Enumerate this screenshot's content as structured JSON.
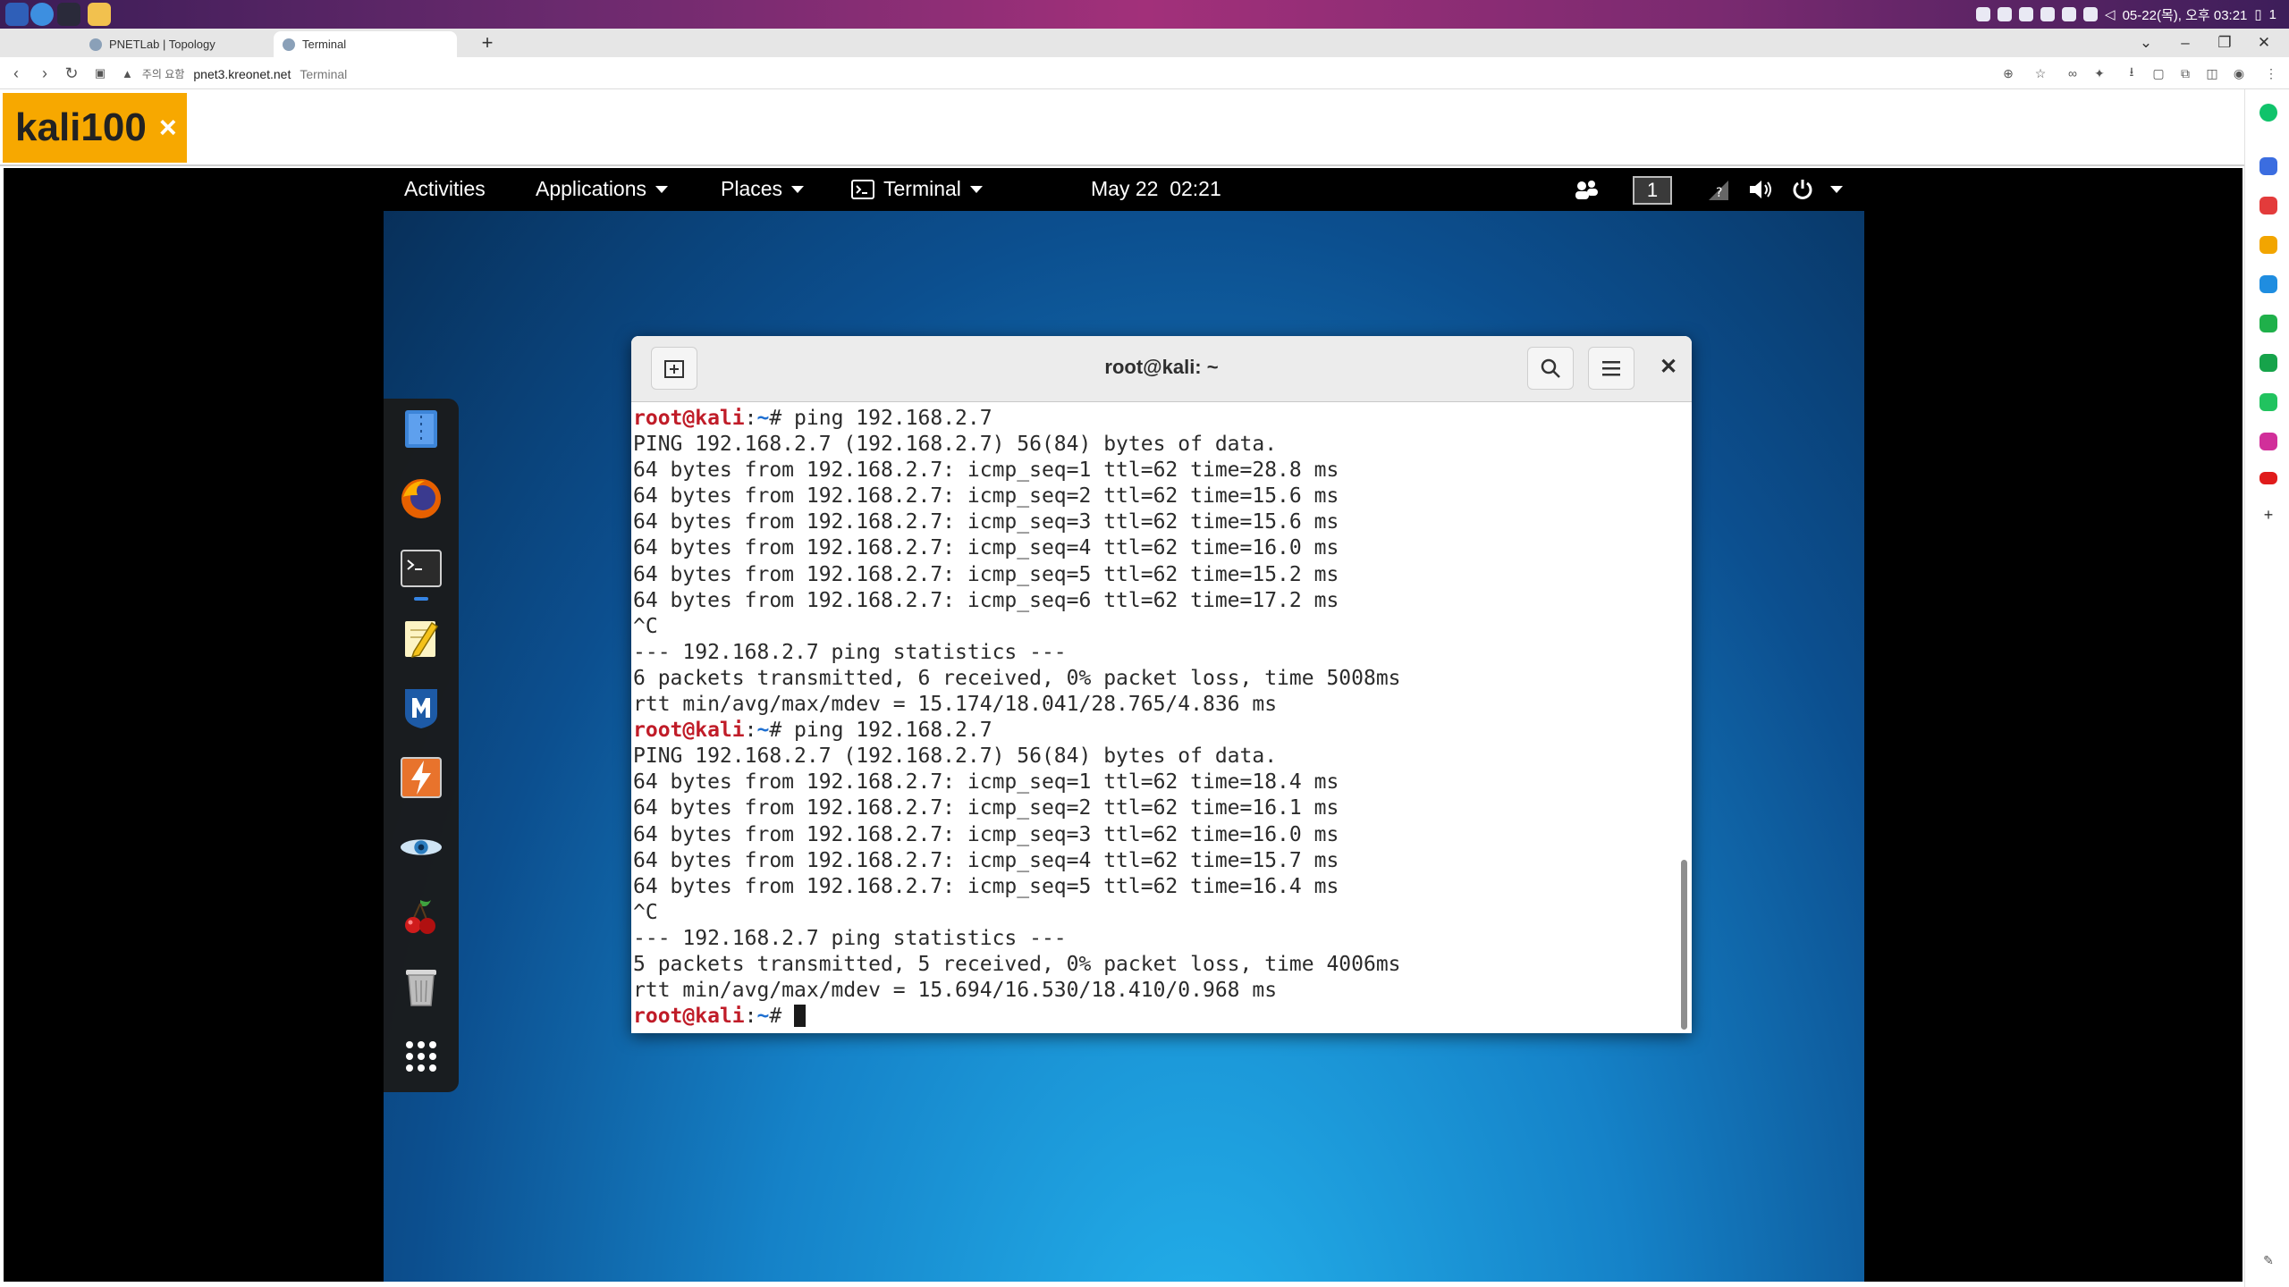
{
  "browser": {
    "tabs": [
      {
        "label": "PNETLab | Topology",
        "active": false
      },
      {
        "label": "Terminal",
        "active": true
      }
    ],
    "address": {
      "security_warning": "주의 요함",
      "url": "pnet3.kreonet.net",
      "page_title": "Terminal"
    }
  },
  "os": {
    "clock": "05-22(목), 오후 03:21",
    "tray_extra": "1"
  },
  "console": {
    "tab_name": "kali100",
    "close_glyph": "×"
  },
  "gnome": {
    "activities": "Activities",
    "applications": "Applications",
    "places": "Places",
    "terminal_menu": "Terminal",
    "clock": "May 22  02:21",
    "workspace": "1"
  },
  "dock_apps": [
    "file-manager",
    "firefox",
    "terminal",
    "text-editor",
    "metasploit",
    "burpsuite",
    "maltego",
    "cherrytree",
    "trash",
    "show-applications"
  ],
  "terminal": {
    "title": "root@kali: ~",
    "prompt_user": "root@kali",
    "prompt_sep": ":",
    "prompt_path": "~",
    "prompt_end": "# ",
    "lines": [
      {
        "type": "prompt",
        "cmd": "ping 192.168.2.7"
      },
      {
        "type": "out",
        "text": "PING 192.168.2.7 (192.168.2.7) 56(84) bytes of data."
      },
      {
        "type": "out",
        "text": "64 bytes from 192.168.2.7: icmp_seq=1 ttl=62 time=28.8 ms"
      },
      {
        "type": "out",
        "text": "64 bytes from 192.168.2.7: icmp_seq=2 ttl=62 time=15.6 ms"
      },
      {
        "type": "out",
        "text": "64 bytes from 192.168.2.7: icmp_seq=3 ttl=62 time=15.6 ms"
      },
      {
        "type": "out",
        "text": "64 bytes from 192.168.2.7: icmp_seq=4 ttl=62 time=16.0 ms"
      },
      {
        "type": "out",
        "text": "64 bytes from 192.168.2.7: icmp_seq=5 ttl=62 time=15.2 ms"
      },
      {
        "type": "out",
        "text": "64 bytes from 192.168.2.7: icmp_seq=6 ttl=62 time=17.2 ms"
      },
      {
        "type": "out",
        "text": "^C"
      },
      {
        "type": "out",
        "text": "--- 192.168.2.7 ping statistics ---"
      },
      {
        "type": "out",
        "text": "6 packets transmitted, 6 received, 0% packet loss, time 5008ms"
      },
      {
        "type": "out",
        "text": "rtt min/avg/max/mdev = 15.174/18.041/28.765/4.836 ms"
      },
      {
        "type": "prompt",
        "cmd": "ping 192.168.2.7"
      },
      {
        "type": "out",
        "text": "PING 192.168.2.7 (192.168.2.7) 56(84) bytes of data."
      },
      {
        "type": "out",
        "text": "64 bytes from 192.168.2.7: icmp_seq=1 ttl=62 time=18.4 ms"
      },
      {
        "type": "out",
        "text": "64 bytes from 192.168.2.7: icmp_seq=2 ttl=62 time=16.1 ms"
      },
      {
        "type": "out",
        "text": "64 bytes from 192.168.2.7: icmp_seq=3 ttl=62 time=16.0 ms"
      },
      {
        "type": "out",
        "text": "64 bytes from 192.168.2.7: icmp_seq=4 ttl=62 time=15.7 ms"
      },
      {
        "type": "out",
        "text": "64 bytes from 192.168.2.7: icmp_seq=5 ttl=62 time=16.4 ms"
      },
      {
        "type": "out",
        "text": "^C"
      },
      {
        "type": "out",
        "text": "--- 192.168.2.7 ping statistics ---"
      },
      {
        "type": "out",
        "text": "5 packets transmitted, 5 received, 0% packet loss, time 4006ms"
      },
      {
        "type": "out",
        "text": "rtt min/avg/max/mdev = 15.694/16.530/18.410/0.968 ms"
      },
      {
        "type": "prompt",
        "cmd": "",
        "cursor": true
      }
    ]
  },
  "colors": {
    "console_tab": "#f7a800",
    "prompt_user": "#c01c28",
    "prompt_path": "#1e6fd1",
    "desktop": "#1582c8"
  }
}
